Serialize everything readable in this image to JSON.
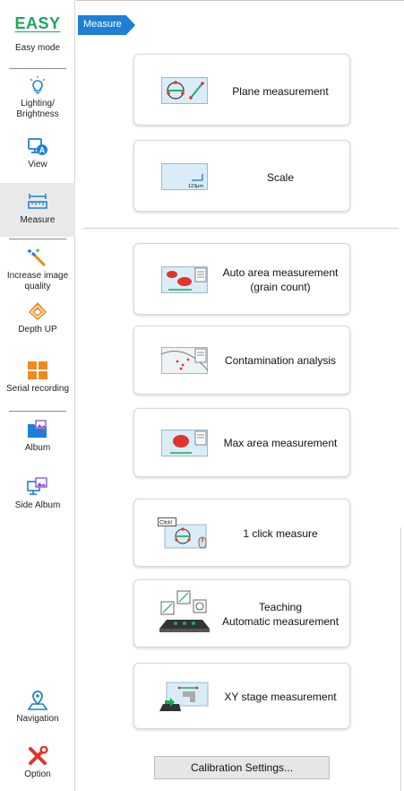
{
  "sidebar": {
    "logo": "EASY",
    "items": [
      {
        "label": "Easy mode"
      },
      {
        "label": "Lighting/ Brightness"
      },
      {
        "label": "View"
      },
      {
        "label": "Measure"
      },
      {
        "label": "Increase image quality"
      },
      {
        "label": "Depth UP"
      },
      {
        "label": "Serial recording"
      },
      {
        "label": "Album"
      },
      {
        "label": "Side Album"
      },
      {
        "label": "Navigation"
      },
      {
        "label": "Option"
      }
    ]
  },
  "breadcrumb": {
    "label": "Measure"
  },
  "cards": [
    {
      "label": "Plane measurement"
    },
    {
      "label": "Scale",
      "thumb_text": "123μm"
    },
    {
      "label": "Auto area measurement\n(grain count)"
    },
    {
      "label": "Contamination analysis"
    },
    {
      "label": "Max area measurement"
    },
    {
      "label": "1 click measure",
      "thumb_text": "Click!"
    },
    {
      "label": "Teaching\nAutomatic measurement"
    },
    {
      "label": "XY stage measurement"
    }
  ],
  "calibration": {
    "label": "Calibration Settings..."
  },
  "colors": {
    "accent": "#1f7fd6",
    "easy_green": "#1aa85a",
    "orange": "#f08a1c",
    "measure_red": "#e0342c"
  }
}
